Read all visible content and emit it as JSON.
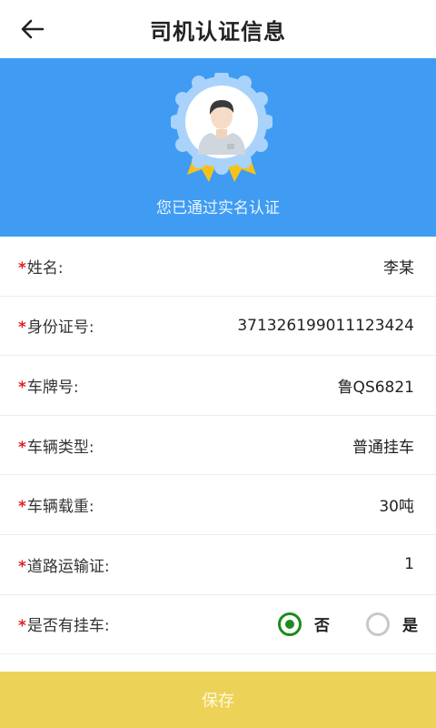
{
  "header": {
    "title": "司机认证信息",
    "back_icon": "arrow-left-icon"
  },
  "hero": {
    "status_text": "您已通过实名认证",
    "background": "#3f9cf2",
    "badge_icon": "verified-user-badge-icon"
  },
  "fields": [
    {
      "label": "姓名:",
      "value": "李某"
    },
    {
      "label": "身份证号:",
      "value": "371326199011123424"
    },
    {
      "label": "车牌号:",
      "value": "鲁QS6821"
    },
    {
      "label": "车辆类型:",
      "value": "普通挂车"
    },
    {
      "label": "车辆载重:",
      "value": "30吨"
    },
    {
      "label": "道路运输证:",
      "value": "1"
    }
  ],
  "trailer": {
    "label": "是否有挂车:",
    "options": [
      {
        "label": "否",
        "checked": true
      },
      {
        "label": "是",
        "checked": false
      }
    ]
  },
  "required_mark": "*",
  "save": {
    "label": "保存",
    "color": "#ecd357"
  }
}
